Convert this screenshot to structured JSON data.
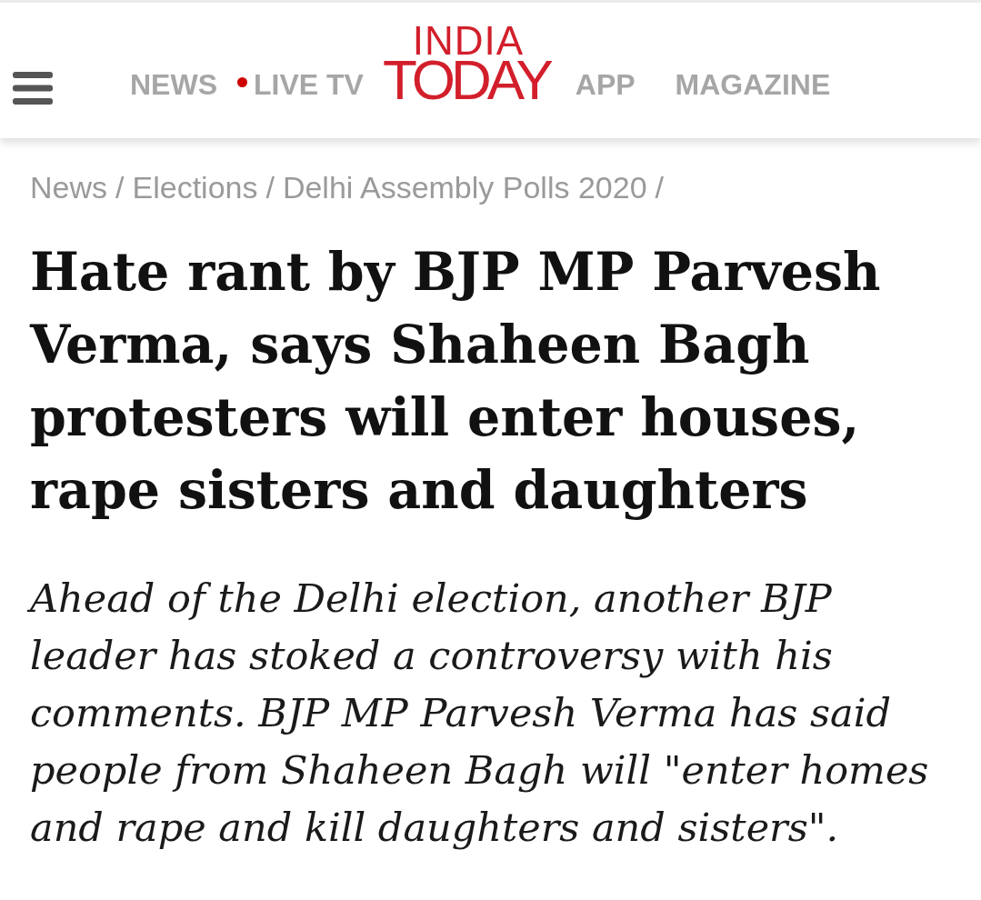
{
  "header": {
    "nav_left": [
      {
        "label": "NEWS",
        "live": false
      },
      {
        "label": "LIVE TV",
        "live": true
      }
    ],
    "logo": {
      "lines": [
        "INDIA",
        "TODAY"
      ]
    },
    "nav_right": [
      {
        "label": "APP"
      },
      {
        "label": "MAGAZINE"
      }
    ]
  },
  "breadcrumb": [
    {
      "label": "News",
      "separator": "/"
    },
    {
      "label": "Elections",
      "separator": "/"
    },
    {
      "label": "Delhi Assembly Polls 2020",
      "separator": "/"
    }
  ],
  "headline": "Hate rant by BJP MP Parvesh Verma, says Shaheen Bagh protesters will enter houses, rape sisters and daughters",
  "summary": "Ahead of the Delhi election, another BJP leader has stoked a controversy with his comments. BJP MP Parvesh Verma has said people from Shaheen Bagh will \"enter homes and rape and kill daughters and sisters\"."
}
